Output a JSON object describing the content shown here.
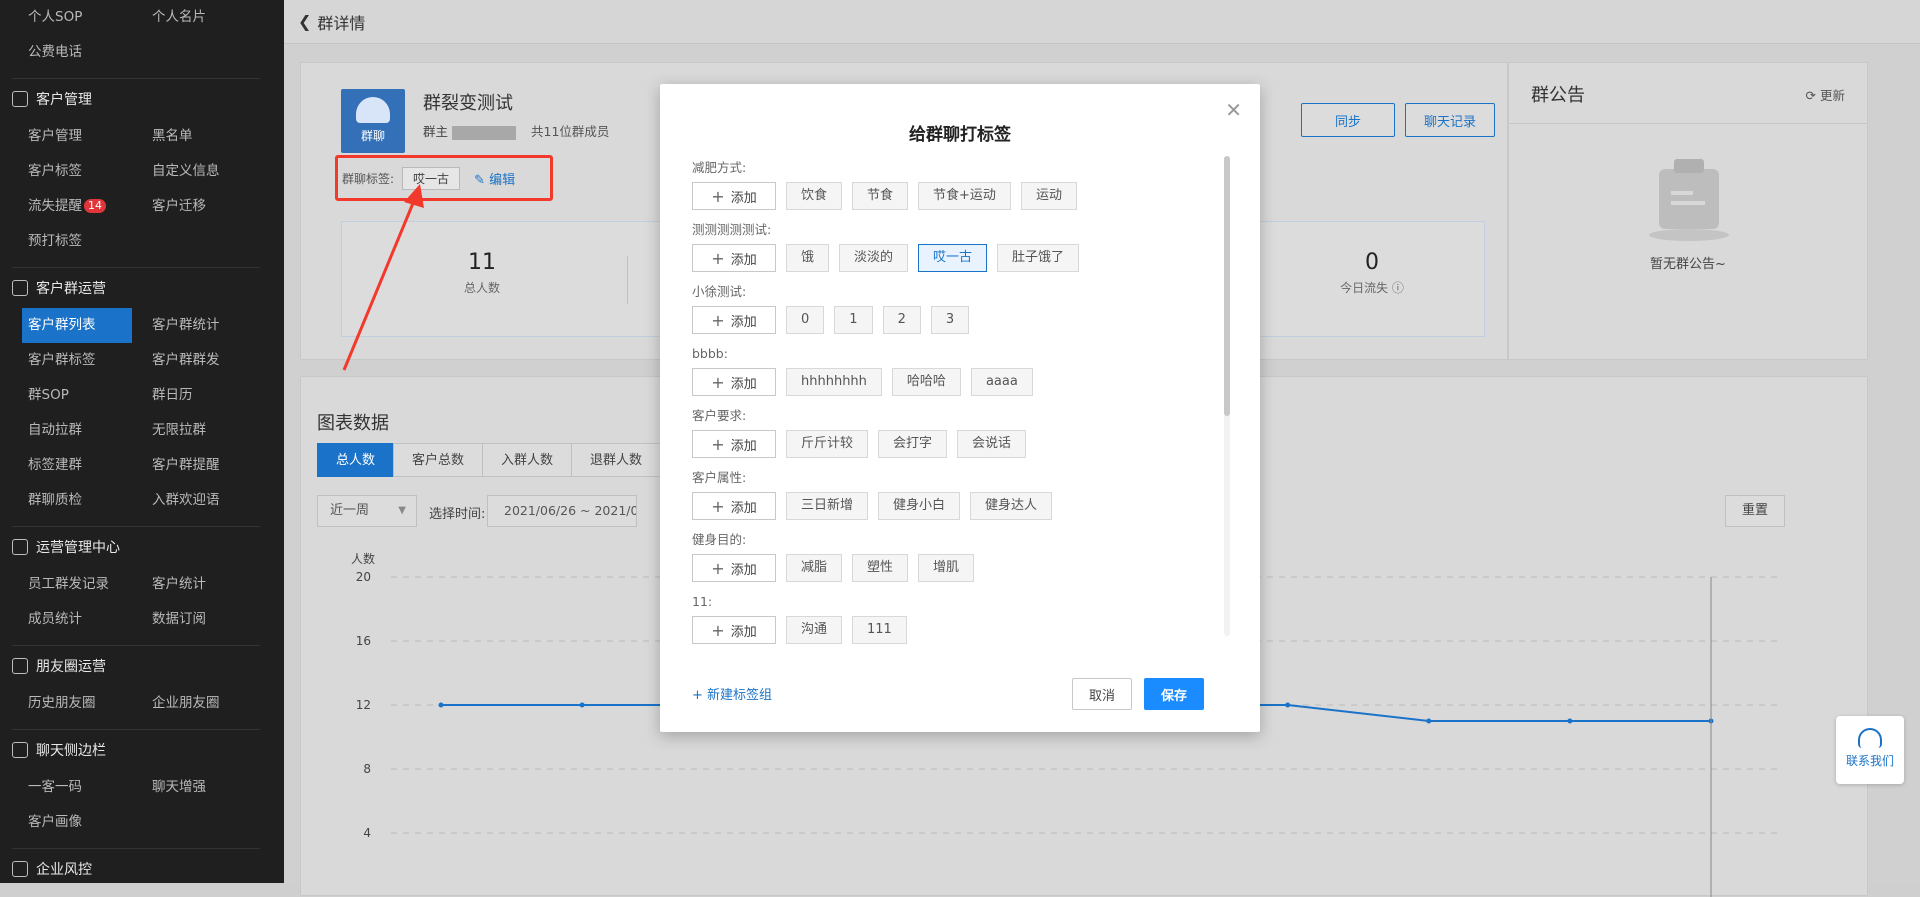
{
  "sidebar": {
    "top_items": [
      {
        "label": "个人SOP"
      },
      {
        "label": "个人名片"
      },
      {
        "label": "公费电话"
      }
    ],
    "groups": [
      {
        "title": "客户管理",
        "items": [
          "客户管理",
          "黑名单",
          "客户标签",
          "自定义信息",
          "流失提醒",
          "客户迁移",
          "预打标签"
        ]
      },
      {
        "title": "客户群运营",
        "items": [
          "客户群列表",
          "客户群统计",
          "客户群标签",
          "客户群群发",
          "群SOP",
          "群日历",
          "自动拉群",
          "无限拉群",
          "标签建群",
          "客户群提醒",
          "群聊质检",
          "入群欢迎语"
        ]
      },
      {
        "title": "运营管理中心",
        "items": [
          "员工群发记录",
          "客户统计",
          "成员统计",
          "数据订阅"
        ]
      },
      {
        "title": "朋友圈运营",
        "items": [
          "历史朋友圈",
          "企业朋友圈"
        ]
      },
      {
        "title": "聊天侧边栏",
        "items": [
          "一客一码",
          "聊天增强",
          "客户画像"
        ]
      },
      {
        "title": "企业风控",
        "items": []
      }
    ],
    "badge_count": "14",
    "active_item": "客户群列表"
  },
  "topbar": {
    "title": "群详情"
  },
  "group": {
    "avatar_label": "群聊",
    "name": "群裂变测试",
    "owner_prefix": "群主",
    "members": "共11位群成员",
    "tag_label": "群聊标签:",
    "tag_value": "哎一古",
    "edit_label": "编辑",
    "sync_label": "同步",
    "chat_record_label": "聊天记录",
    "stats": [
      {
        "value": "11",
        "label": "总人数"
      },
      {
        "value": "0",
        "label": "今日流失"
      }
    ]
  },
  "notice": {
    "title": "群公告",
    "refresh": "更新",
    "empty": "暂无群公告~"
  },
  "chart_section": {
    "title": "图表数据",
    "tabs": [
      "总人数",
      "客户总数",
      "入群人数",
      "退群人数"
    ],
    "range": "近一周",
    "date_label": "选择时间:",
    "date_value": "2021/06/26 ~ 2021/0",
    "reset": "重置"
  },
  "chart_data": {
    "type": "line",
    "ylabel": "人数",
    "ylim": [
      0,
      20
    ],
    "yticks": [
      4,
      8,
      12,
      16,
      20
    ],
    "series": [
      {
        "values": [
          12,
          12,
          12,
          12,
          12,
          12,
          12,
          11,
          11,
          11
        ]
      }
    ],
    "color": "#1a73c8"
  },
  "contact": {
    "label": "联系我们"
  },
  "modal": {
    "title": "给群聊打标签",
    "add_label": "添加",
    "groups": [
      {
        "name": "减肥方式:",
        "tags": [
          "饮食",
          "节食",
          "节食+运动",
          "运动"
        ]
      },
      {
        "name": "测测测测测试:",
        "tags": [
          "饿",
          "淡淡的",
          "哎一古",
          "肚子饿了"
        ],
        "selected": 2
      },
      {
        "name": "小徐测试:",
        "tags": [
          "0",
          "1",
          "2",
          "3"
        ]
      },
      {
        "name": "bbbb:",
        "tags": [
          "hhhhhhhh",
          "哈哈哈",
          "aaaa"
        ]
      },
      {
        "name": "客户要求:",
        "tags": [
          "斤斤计较",
          "会打字",
          "会说话"
        ]
      },
      {
        "name": "客户属性:",
        "tags": [
          "三日新增",
          "健身小白",
          "健身达人"
        ]
      },
      {
        "name": "健身目的:",
        "tags": [
          "减脂",
          "塑性",
          "增肌"
        ]
      },
      {
        "name": "11:",
        "tags": [
          "沟通",
          "111"
        ]
      }
    ],
    "new_group": "新建标签组",
    "cancel": "取消",
    "save": "保存"
  }
}
